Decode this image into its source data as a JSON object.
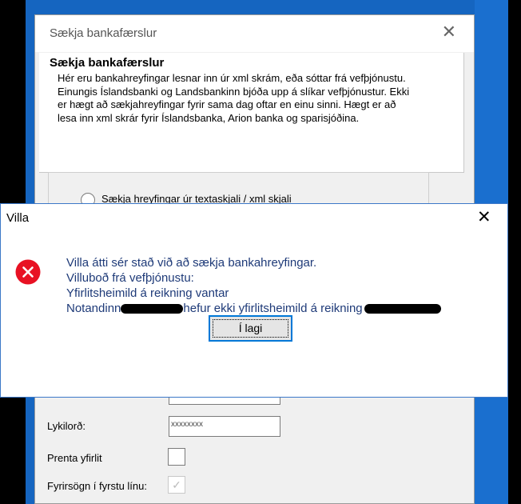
{
  "background_dialog": {
    "title": "Sækja bankafærslur",
    "close_glyph": "✕",
    "info": {
      "heading": "Sækja bankafærslur",
      "text": "Hér eru bankahreyfingar lesnar inn úr xml skrám, eða sóttar frá vefþjónustu. Einungis Íslandsbanki og Landsbankinn bjóða upp á slíkar vefþjónustur.  Ekki er hægt að sækjahreyfingar fyrir sama dag oftar en einu sinni.  Hægt er að lesa inn xml skrár fyrir Íslandsbanka, Arion banka og sparisjóðina."
    },
    "radio_label": "Sækja hreyfingar úr textaskjali / xml skjali",
    "password_label": "Lykilorð:",
    "password_value": "xxxxxxxx",
    "print_statement_label": "Prenta yfirlit",
    "header_first_line_label": "Fyrirsögn í fyrstu línu:",
    "header_first_line_checked": true
  },
  "error_dialog": {
    "title": "Villa",
    "close_glyph": "✕",
    "icon": "error-icon",
    "lines": {
      "line1": "Villa átti sér stað við að sækja bankahreyfingar.",
      "line2": "Villuboð frá vefþjónustu:",
      "line3": "Yfirlitsheimild á reikning vantar",
      "line4_part1": "Notandinn",
      "line4_part2": "hefur ekki yfirlitsheimild á reikning"
    },
    "ok_label": "Í lagi"
  },
  "colors": {
    "desktop_blue": "#1565c0",
    "error_red": "#e81123",
    "message_text": "#1e3a78",
    "button_focus": "#0078d7"
  }
}
